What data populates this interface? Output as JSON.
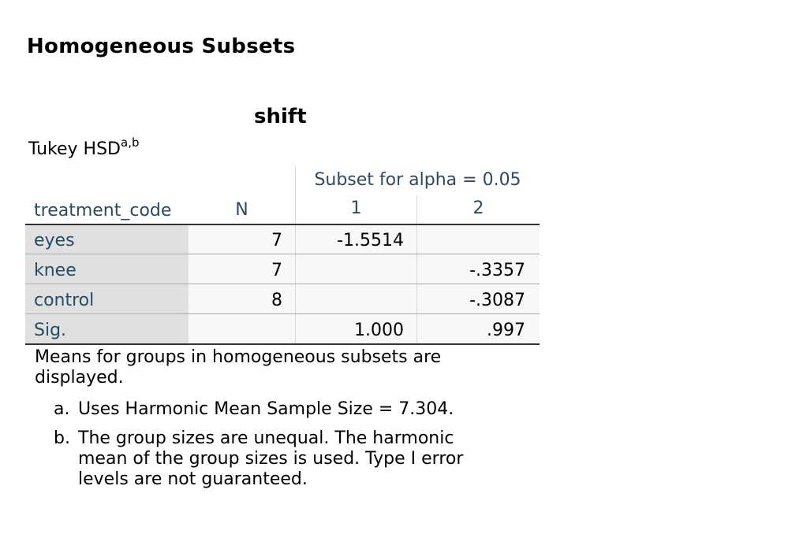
{
  "heading": "Homogeneous Subsets",
  "table": {
    "title": "shift",
    "subtitle": "Tukey HSD",
    "subtitle_sup": "a,b",
    "spanner": "Subset for alpha = 0.05",
    "col_headers": {
      "row_var": "treatment_code",
      "n": "N",
      "subset1": "1",
      "subset2": "2"
    },
    "rows": [
      {
        "label": "eyes",
        "n": "7",
        "s1": "-1.5514",
        "s2": ""
      },
      {
        "label": "knee",
        "n": "7",
        "s1": "",
        "s2": "-.3357"
      },
      {
        "label": "control",
        "n": "8",
        "s1": "",
        "s2": "-.3087"
      },
      {
        "label": "Sig.",
        "n": "",
        "s1": "1.000",
        "s2": ".997"
      }
    ]
  },
  "footnotes": {
    "note": "Means for groups in homogeneous subsets are displayed.",
    "a_mark": "a.",
    "a_text": "Uses Harmonic Mean Sample Size = 7.304.",
    "b_mark": "b.",
    "b_text": "The group sizes are unequal. The harmonic mean of the group sizes is used. Type I error levels are not guaranteed."
  }
}
